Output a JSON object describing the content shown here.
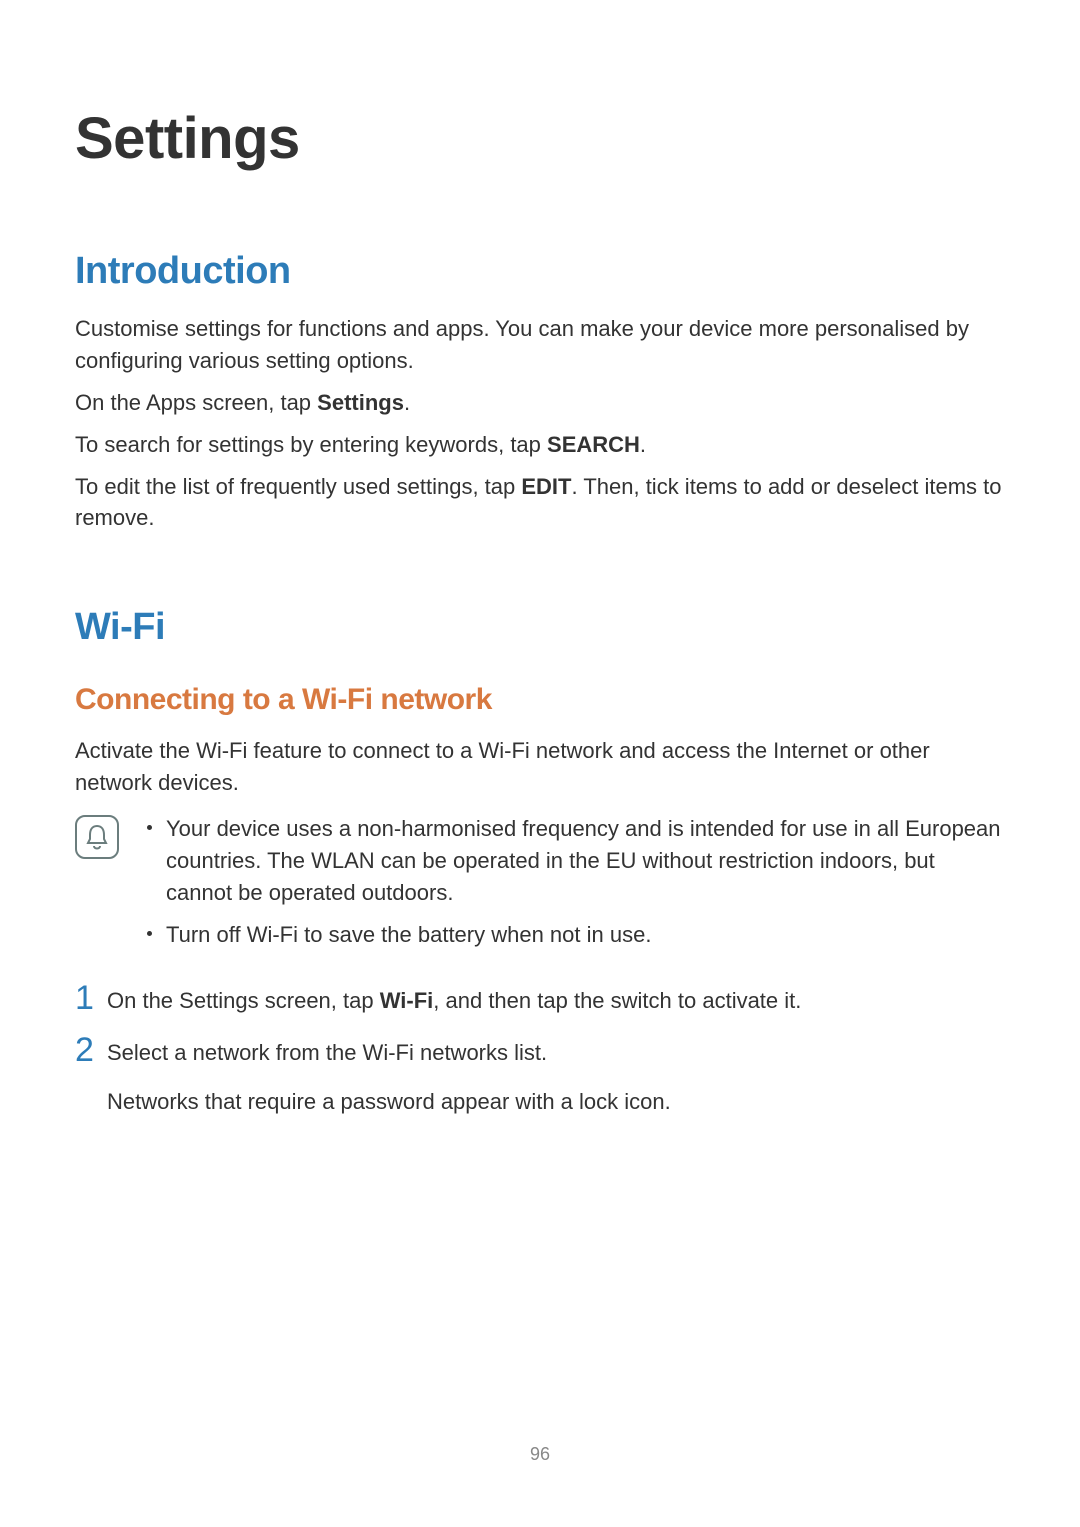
{
  "page_title": "Settings",
  "introduction": {
    "heading": "Introduction",
    "para1": "Customise settings for functions and apps. You can make your device more personalised by configuring various setting options.",
    "para2_pre": "On the Apps screen, tap ",
    "para2_bold": "Settings",
    "para2_post": ".",
    "para3_pre": "To search for settings by entering keywords, tap ",
    "para3_bold": "SEARCH",
    "para3_post": ".",
    "para4_pre": "To edit the list of frequently used settings, tap ",
    "para4_bold": "EDIT",
    "para4_post": ". Then, tick items to add or deselect items to remove."
  },
  "wifi": {
    "heading": "Wi-Fi",
    "subheading": "Connecting to a Wi-Fi network",
    "para": "Activate the Wi-Fi feature to connect to a Wi-Fi network and access the Internet or other network devices.",
    "notes": [
      "Your device uses a non-harmonised frequency and is intended for use in all European countries. The WLAN can be operated in the EU without restriction indoors, but cannot be operated outdoors.",
      "Turn off Wi-Fi to save the battery when not in use."
    ],
    "steps": {
      "s1_num": "1",
      "s1_pre": "On the Settings screen, tap ",
      "s1_bold": "Wi-Fi",
      "s1_post": ", and then tap the switch to activate it.",
      "s2_num": "2",
      "s2_text": "Select a network from the Wi-Fi networks list.",
      "s2_sub": "Networks that require a password appear with a lock icon."
    }
  },
  "page_number": "96"
}
